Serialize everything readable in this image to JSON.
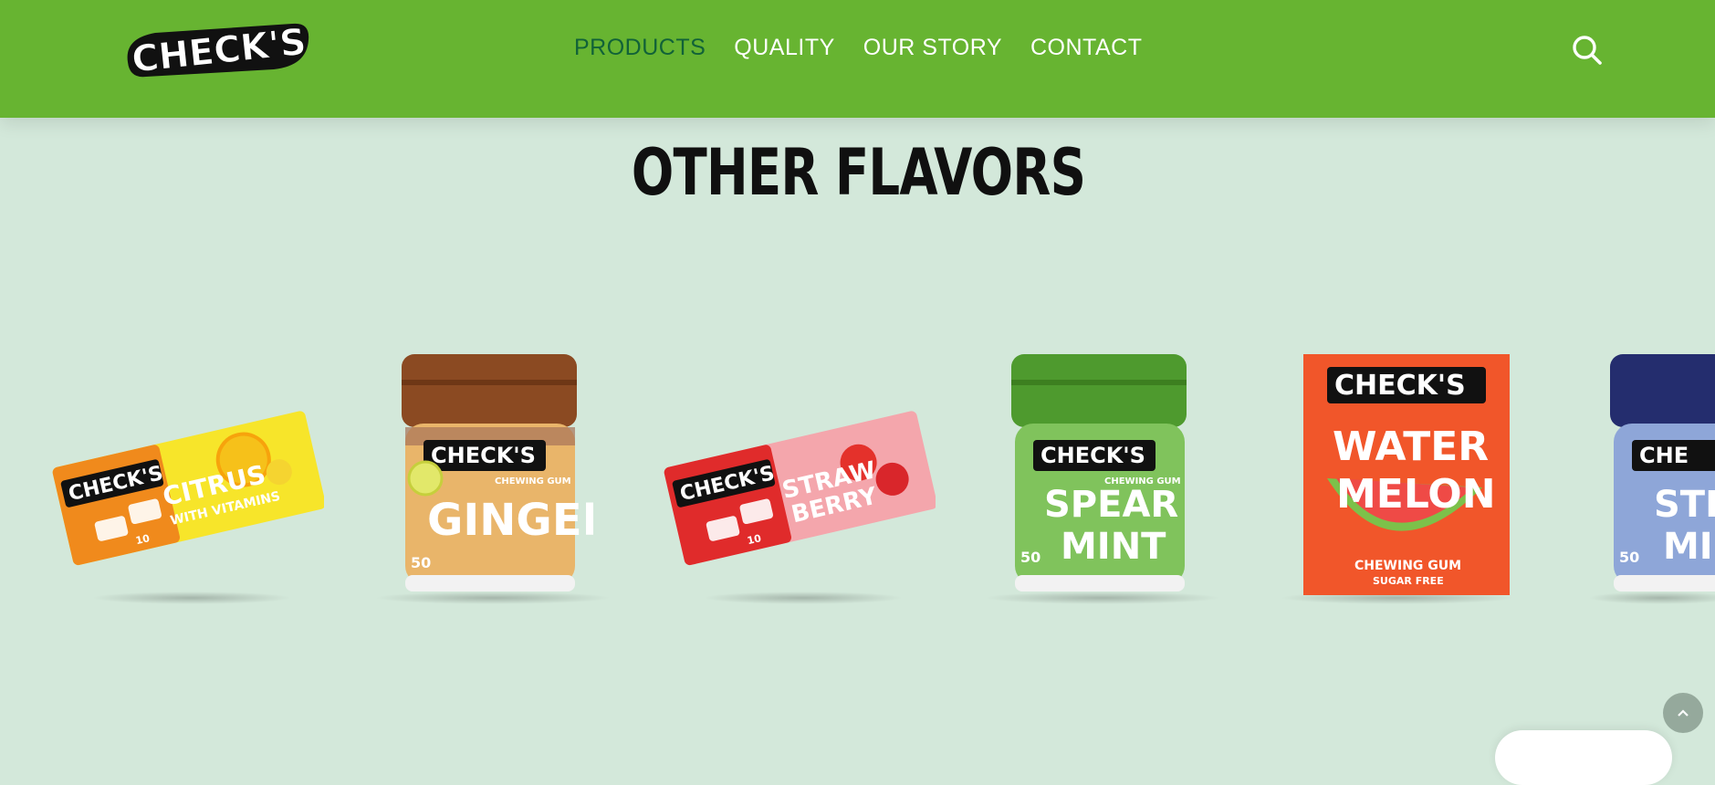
{
  "brand": {
    "logo_text": "CHECK'S"
  },
  "nav": {
    "items": [
      {
        "label": "PRODUCTS",
        "active": true
      },
      {
        "label": "QUALITY",
        "active": false
      },
      {
        "label": "OUR STORY",
        "active": false
      },
      {
        "label": "CONTACT",
        "active": false
      }
    ],
    "search_icon": "search-icon"
  },
  "section": {
    "title": "OTHER FLAVORS"
  },
  "products": [
    {
      "name": "CITRUS",
      "sub": "WITH VITAMINS",
      "pack": "blister",
      "count": "10",
      "brand": "CHECK'S"
    },
    {
      "name": "GINGER",
      "pack": "jar",
      "count": "50",
      "brand": "CHECK'S",
      "tag": "CHEWING GUM"
    },
    {
      "name": "STRAW",
      "name2": "BERRY",
      "pack": "blister",
      "count": "10",
      "brand": "CHECK'S"
    },
    {
      "name": "SPEAR",
      "name2": "MINT",
      "pack": "jar",
      "count": "50",
      "brand": "CHECK'S",
      "tag": "CHEWING GUM"
    },
    {
      "name": "WATER",
      "name2": "MELON",
      "pack": "box",
      "brand": "CHECK'S",
      "tag": "CHEWING GUM",
      "tag2": "SUGAR FREE"
    },
    {
      "name": "STR",
      "name2": "MI",
      "pack": "jar",
      "count": "50",
      "brand": "CHE"
    }
  ],
  "colors": {
    "header": "#67b431",
    "background": "#d3e8da",
    "nav_active": "#116238"
  },
  "widgets": {
    "scroll_top_icon": "chevron-up-icon",
    "chat_icon": "chat-bubble"
  }
}
